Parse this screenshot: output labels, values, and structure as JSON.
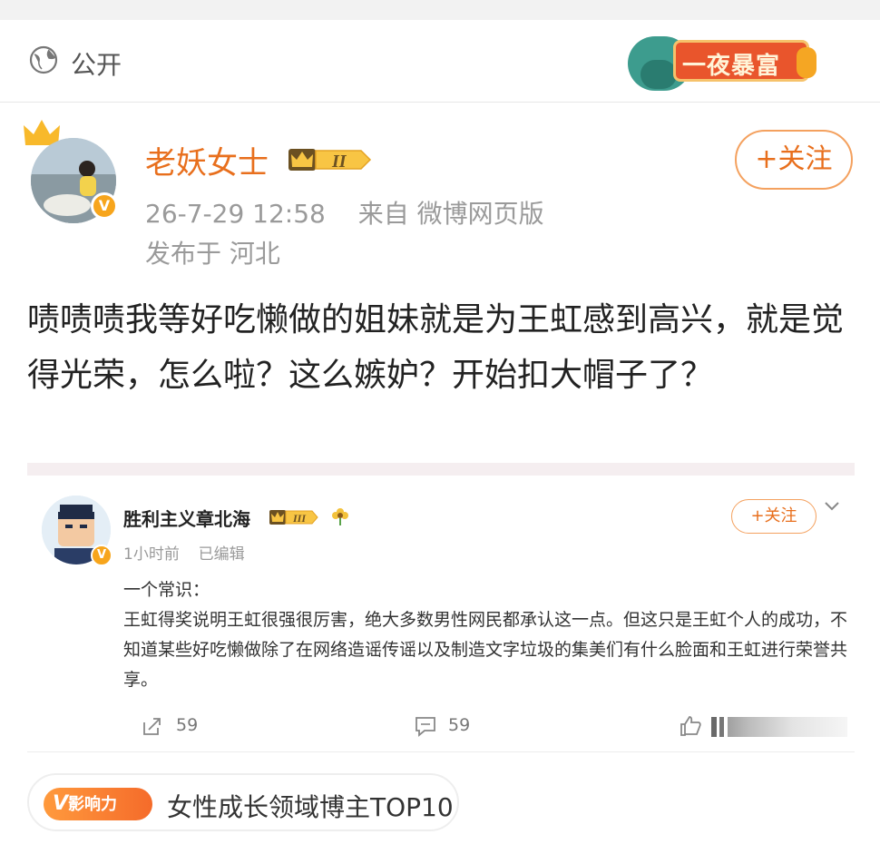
{
  "visibility": {
    "label": "公开",
    "icon": "globe-icon"
  },
  "promo": {
    "text": "一夜暴富"
  },
  "post": {
    "author": "老妖女士",
    "level": "II",
    "time": "26-7-29 12:58",
    "source": "来自 微博网页版",
    "location": "发布于 河北",
    "follow_label": "+关注",
    "body": "啧啧啧我等好吃懒做的姐妹就是为王虹感到高兴，就是觉得光荣，怎么啦？这么嫉妒？开始扣大帽子了？"
  },
  "comment": {
    "author": "胜利主义章北海",
    "level": "III",
    "time": "1小时前",
    "edited": "已编辑",
    "follow_label": "+关注",
    "line1": "一个常识：",
    "line2": "王虹得奖说明王虹很强很厉害，绝大多数男性网民都承认这一点。但这只是王虹个人的成功，不知道某些好吃懒做除了在网络造谣传谣以及制造文字垃圾的集美们有什么脸面和王虹进行荣誉共享。",
    "reposts": "59",
    "comments": "59"
  },
  "influence": {
    "badge": "影响力",
    "badge_v": "V",
    "text": "女性成长领域博主TOP10"
  },
  "colors": {
    "accent": "#e86f1d",
    "badge": "#f7a51c",
    "gray": "#9a9a9a"
  }
}
